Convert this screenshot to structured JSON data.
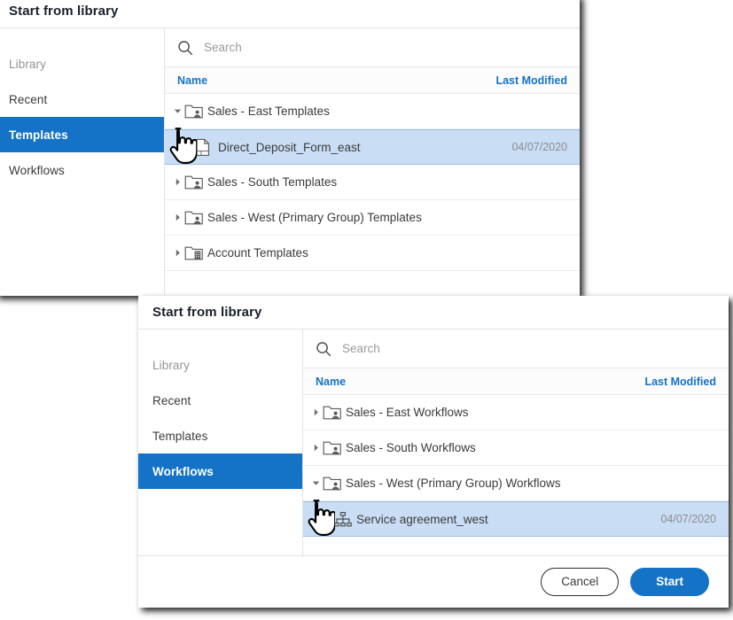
{
  "colors": {
    "accent": "#1473c6",
    "selected_row": "#c9ddf5",
    "header_link": "#1473c6",
    "text": "#3b3b3b",
    "muted": "#8d8d8d"
  },
  "dialog_templates": {
    "title": "Start from library",
    "search": {
      "placeholder": "Search",
      "value": "",
      "icon": "search-icon"
    },
    "columns": {
      "name": "Name",
      "last_modified": "Last Modified"
    },
    "sidebar": {
      "items": [
        {
          "label": "Library",
          "state": "muted"
        },
        {
          "label": "Recent",
          "state": "normal"
        },
        {
          "label": "Templates",
          "state": "active"
        },
        {
          "label": "Workflows",
          "state": "normal"
        }
      ]
    },
    "rows": [
      {
        "label": "Sales - East Templates",
        "icon": "group-folder-icon",
        "twisty": "expanded",
        "level": 0,
        "date": "",
        "selected": false
      },
      {
        "label": "Direct_Deposit_Form_east",
        "icon": "document-icon",
        "twisty": "none",
        "level": 1,
        "date": "04/07/2020",
        "selected": true
      },
      {
        "label": "Sales - South Templates",
        "icon": "group-folder-icon",
        "twisty": "collapsed",
        "level": 0,
        "date": "",
        "selected": false
      },
      {
        "label": "Sales - West (Primary Group) Templates",
        "icon": "group-folder-icon",
        "twisty": "collapsed",
        "level": 0,
        "date": "",
        "selected": false
      },
      {
        "label": "Account Templates",
        "icon": "account-folder-icon",
        "twisty": "collapsed",
        "level": 0,
        "date": "",
        "selected": false
      }
    ]
  },
  "dialog_workflows": {
    "title": "Start from library",
    "search": {
      "placeholder": "Search",
      "value": "",
      "icon": "search-icon"
    },
    "columns": {
      "name": "Name",
      "last_modified": "Last Modified"
    },
    "sidebar": {
      "items": [
        {
          "label": "Library",
          "state": "muted"
        },
        {
          "label": "Recent",
          "state": "normal"
        },
        {
          "label": "Templates",
          "state": "normal"
        },
        {
          "label": "Workflows",
          "state": "active"
        }
      ]
    },
    "rows": [
      {
        "label": "Sales - East Workflows",
        "icon": "group-folder-icon",
        "twisty": "collapsed",
        "level": 0,
        "date": "",
        "selected": false
      },
      {
        "label": "Sales - South Workflows",
        "icon": "group-folder-icon",
        "twisty": "collapsed",
        "level": 0,
        "date": "",
        "selected": false
      },
      {
        "label": "Sales - West (Primary Group) Workflows",
        "icon": "group-folder-icon",
        "twisty": "expanded",
        "level": 0,
        "date": "",
        "selected": false
      },
      {
        "label": "Service agreement_west",
        "icon": "workflow-icon",
        "twisty": "none",
        "level": 1,
        "date": "04/07/2020",
        "selected": true
      }
    ],
    "footer": {
      "cancel_label": "Cancel",
      "start_label": "Start"
    }
  }
}
